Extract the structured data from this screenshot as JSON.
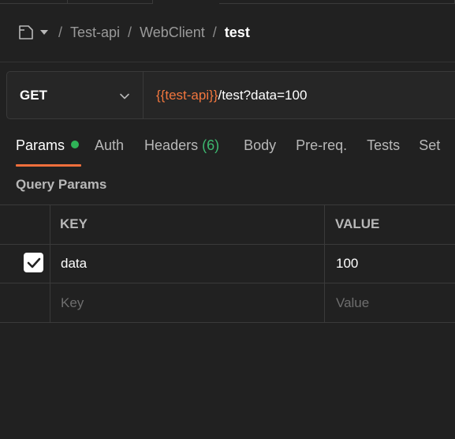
{
  "breadcrumb": {
    "icon": "collection-icon",
    "separator": "/",
    "items": [
      "Test-api",
      "WebClient"
    ],
    "current": "test"
  },
  "request": {
    "method": "GET",
    "url_variable": "{{test-api}}",
    "url_path": "/test?data=100"
  },
  "tabs": {
    "params": "Params",
    "auth": "Auth",
    "headers": "Headers",
    "headers_count": "(6)",
    "body": "Body",
    "prereq": "Pre-req.",
    "tests": "Tests",
    "settings": "Set"
  },
  "query_params": {
    "title": "Query Params",
    "columns": {
      "key": "KEY",
      "value": "VALUE"
    },
    "rows": [
      {
        "checked": true,
        "key": "data",
        "value": "100"
      }
    ],
    "placeholder_key": "Key",
    "placeholder_value": "Value"
  },
  "colors": {
    "background": "#212121",
    "accent": "#f06f3c",
    "variable": "#f2763e",
    "active_dot": "#2fb457",
    "count": "#3db86f"
  }
}
